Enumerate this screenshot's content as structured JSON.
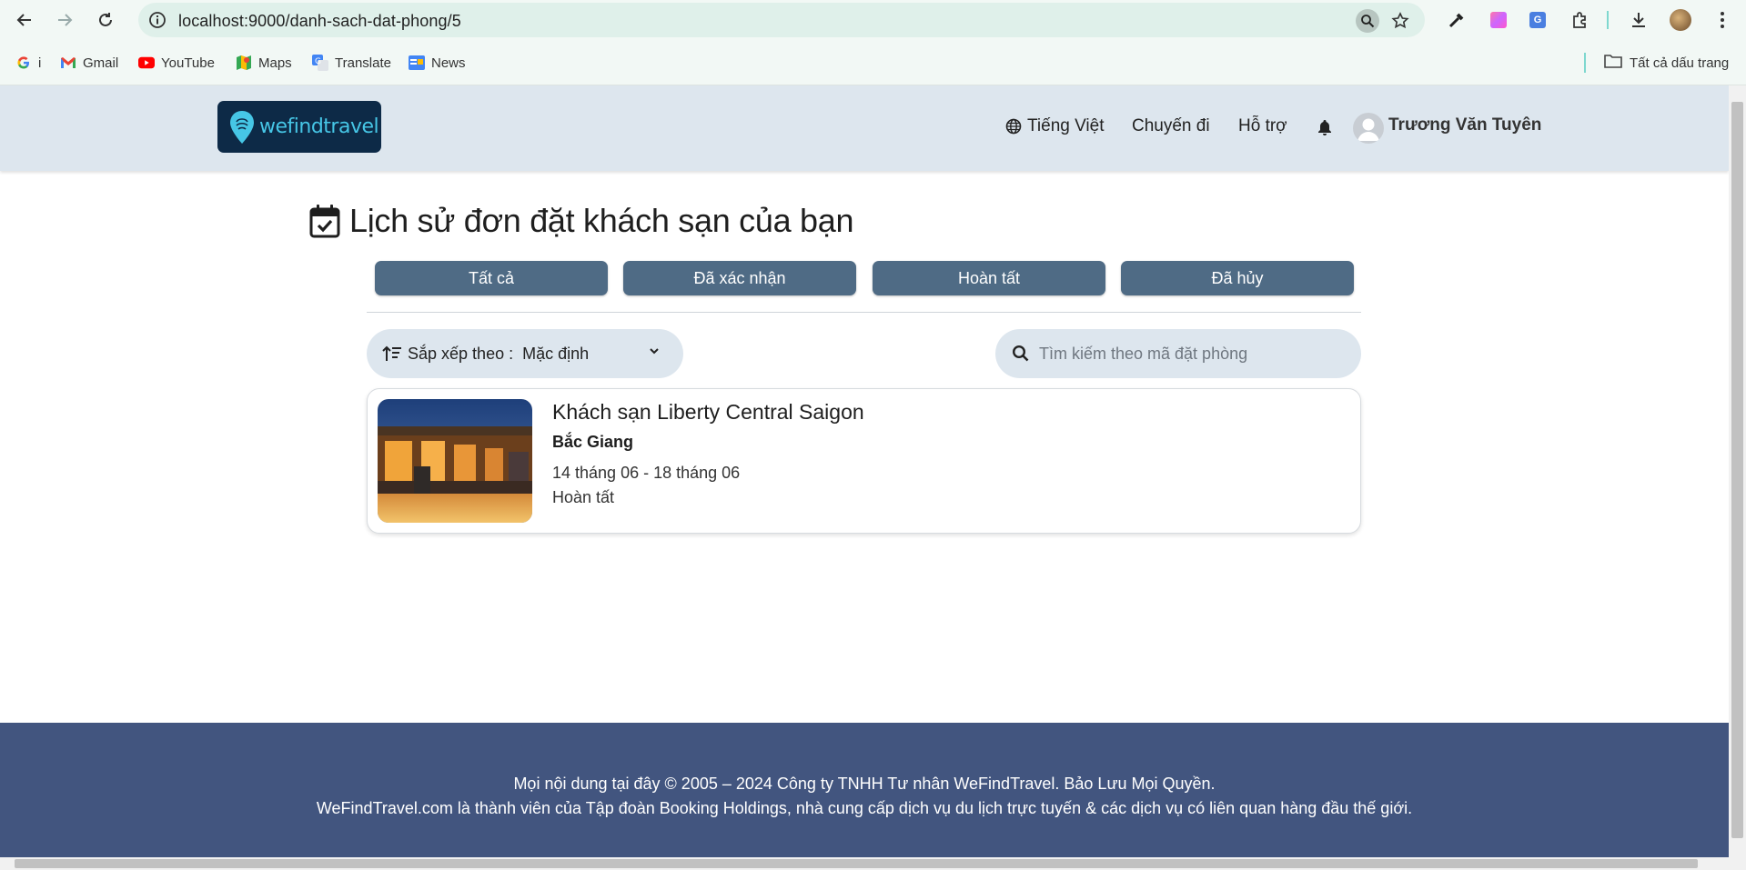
{
  "browser": {
    "url": "localhost:9000/danh-sach-dat-phong/5",
    "bookmarks": [
      {
        "label": "i",
        "icon": "google-icon"
      },
      {
        "label": "Gmail",
        "icon": "gmail-icon"
      },
      {
        "label": "YouTube",
        "icon": "youtube-icon"
      },
      {
        "label": "Maps",
        "icon": "maps-icon"
      },
      {
        "label": "Translate",
        "icon": "translate-icon"
      },
      {
        "label": "News",
        "icon": "news-icon"
      }
    ],
    "all_bookmarks": "Tất cả dấu trang"
  },
  "header": {
    "logo_text": "wefindtravel",
    "language": "Tiếng Việt",
    "trips": "Chuyến đi",
    "support": "Hỗ trợ",
    "user_name": "Trương Văn Tuyên"
  },
  "main": {
    "title": "Lịch sử đơn đặt khách sạn của bạn",
    "filters": [
      "Tất cả",
      "Đã xác nhận",
      "Hoàn tất",
      "Đã hủy"
    ],
    "sort_label": "Sắp xếp theo :",
    "sort_value": "Mặc định",
    "search_placeholder": "Tìm kiếm theo mã đặt phòng",
    "bookings": [
      {
        "hotel": "Khách sạn Liberty Central Saigon",
        "location": "Bắc Giang",
        "dates": "14 tháng 06 - 18 tháng 06",
        "status": "Hoàn tất"
      }
    ]
  },
  "footer": {
    "line1": "Mọi nội dung tại đây © 2005 – 2024 Công ty TNHH Tư nhân WeFindTravel. Bảo Lưu Mọi Quyền.",
    "line2": "WeFindTravel.com là thành viên của Tập đoàn Booking Holdings, nhà cung cấp dịch vụ du lịch trực tuyến & các dịch vụ có liên quan hàng đầu thế giới."
  },
  "colors": {
    "header_bg": "#dde6ee",
    "filter_button": "#4f6b85",
    "footer_bg": "#42557f",
    "logo_bg": "#0d2a47",
    "logo_accent": "#46c6e6"
  }
}
